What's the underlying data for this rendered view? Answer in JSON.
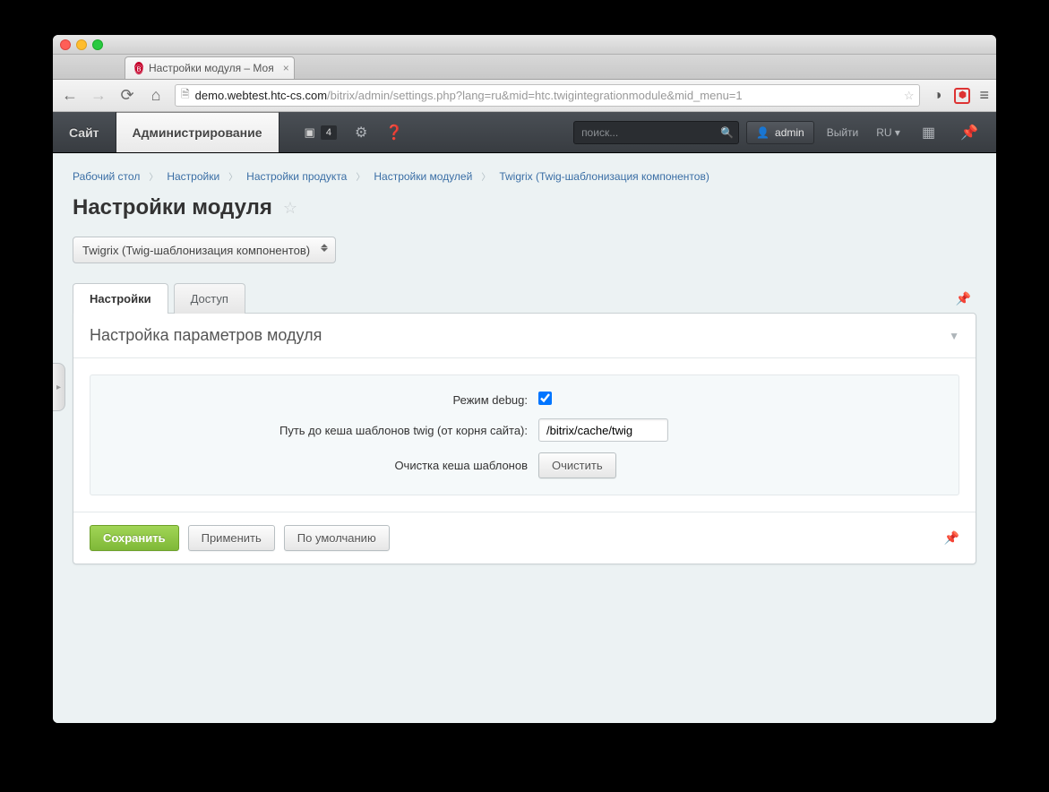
{
  "browser": {
    "tab_title": "Настройки модуля – Моя",
    "url_host": "demo.webtest.htc-cs.com",
    "url_path": "/bitrix/admin/settings.php?lang=ru&mid=htc.twigintegrationmodule&mid_menu=1"
  },
  "header": {
    "tab_site": "Сайт",
    "tab_admin": "Администрирование",
    "notif_count": "4",
    "search_placeholder": "поиск...",
    "user_label": "admin",
    "logout": "Выйти",
    "lang": "RU"
  },
  "breadcrumb": [
    "Рабочий стол",
    "Настройки",
    "Настройки продукта",
    "Настройки модулей",
    "Twigrix (Twig-шаблонизация компонентов)"
  ],
  "page_title": "Настройки модуля",
  "module_select": "Twigrix (Twig-шаблонизация компонентов)",
  "tabs": {
    "settings": "Настройки",
    "access": "Доступ"
  },
  "section_title": "Настройка параметров модуля",
  "form": {
    "debug_label": "Режим debug:",
    "debug_checked": true,
    "cache_path_label": "Путь до кеша шаблонов twig (от корня сайта):",
    "cache_path_value": "/bitrix/cache/twig",
    "clear_label": "Очистка кеша шаблонов",
    "clear_button": "Очистить"
  },
  "buttons": {
    "save": "Сохранить",
    "apply": "Применить",
    "default": "По умолчанию"
  }
}
